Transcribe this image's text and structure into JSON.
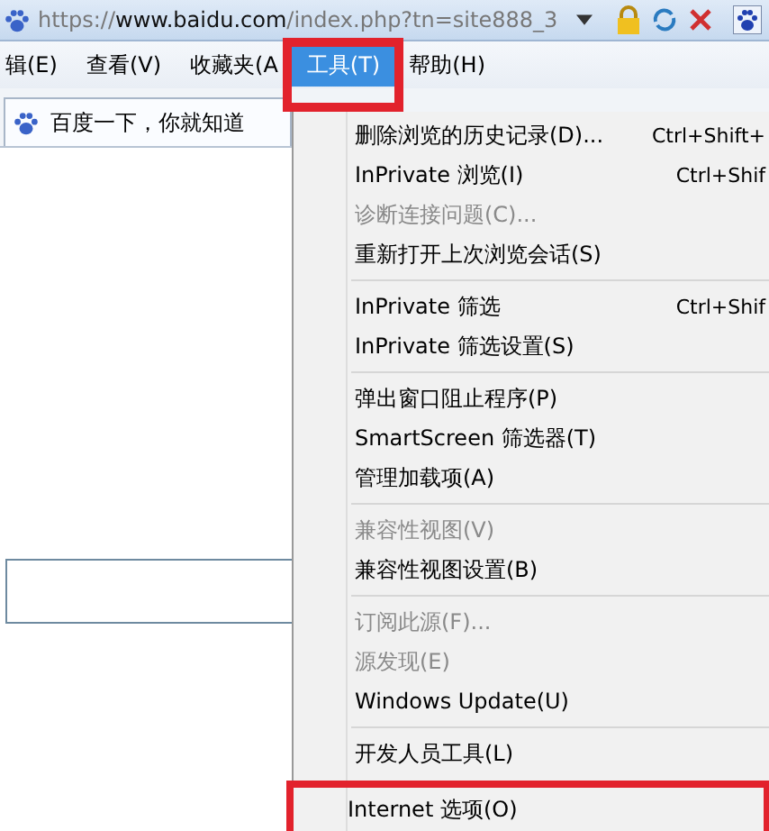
{
  "address_bar": {
    "url": "https://**www.baidu.com**/index.php?tn=site888_3"
  },
  "menu_bar": [
    {
      "label": "辑(E)",
      "selected": false,
      "highlighted": false
    },
    {
      "label": "查看(V)",
      "selected": false,
      "highlighted": false
    },
    {
      "label": "收藏夹(A",
      "selected": false,
      "highlighted": false
    },
    {
      "label": "工具(T)",
      "selected": true,
      "highlighted": true
    },
    {
      "label": "帮助(H)",
      "selected": false,
      "highlighted": false
    }
  ],
  "tab": {
    "title": "百度一下，你就知道"
  },
  "tools_menu": [
    {
      "kind": "item",
      "label": "删除浏览的历史记录(D)...",
      "shortcut": "Ctrl+Shift+",
      "disabled": false,
      "highlighted": false
    },
    {
      "kind": "item",
      "label": "InPrivate 浏览(I)",
      "shortcut": "Ctrl+Shif",
      "disabled": false,
      "highlighted": false
    },
    {
      "kind": "item",
      "label": "诊断连接问题(C)...",
      "disabled": true,
      "highlighted": false
    },
    {
      "kind": "item",
      "label": "重新打开上次浏览会话(S)",
      "disabled": false,
      "highlighted": false
    },
    {
      "kind": "separator"
    },
    {
      "kind": "item",
      "label": "InPrivate 筛选",
      "shortcut": "Ctrl+Shif",
      "disabled": false,
      "highlighted": false
    },
    {
      "kind": "item",
      "label": "InPrivate 筛选设置(S)",
      "disabled": false,
      "highlighted": false
    },
    {
      "kind": "separator"
    },
    {
      "kind": "item",
      "label": "弹出窗口阻止程序(P)",
      "disabled": false,
      "highlighted": false
    },
    {
      "kind": "item",
      "label": "SmartScreen 筛选器(T)",
      "disabled": false,
      "highlighted": false
    },
    {
      "kind": "item",
      "label": "管理加载项(A)",
      "disabled": false,
      "highlighted": false
    },
    {
      "kind": "separator"
    },
    {
      "kind": "item",
      "label": "兼容性视图(V)",
      "disabled": true,
      "highlighted": false
    },
    {
      "kind": "item",
      "label": "兼容性视图设置(B)",
      "disabled": false,
      "highlighted": false
    },
    {
      "kind": "separator"
    },
    {
      "kind": "item",
      "label": "订阅此源(F)...",
      "disabled": true,
      "highlighted": false
    },
    {
      "kind": "item",
      "label": "源发现(E)",
      "disabled": true,
      "highlighted": false
    },
    {
      "kind": "item",
      "label": "Windows Update(U)",
      "disabled": false,
      "highlighted": false
    },
    {
      "kind": "separator"
    },
    {
      "kind": "item",
      "label": "开发人员工具(L)",
      "disabled": false,
      "highlighted": false
    },
    {
      "kind": "item",
      "label": "Internet 选项(O)",
      "disabled": false,
      "highlighted": true
    }
  ]
}
